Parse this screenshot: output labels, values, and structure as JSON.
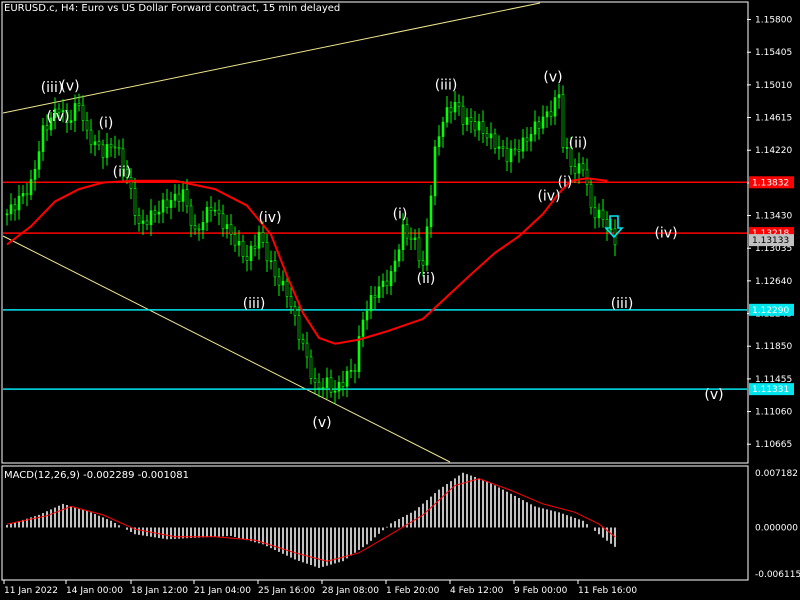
{
  "window": {
    "title": "EURUSD.c, H4:  Euro vs US Dollar Forward contract, 15 min delayed"
  },
  "indicator": {
    "title": "MACD(12,26,9) -0.002289 -0.001081",
    "axis_labels": [
      "0.007182",
      "0.000000",
      "-0.006115"
    ]
  },
  "colors": {
    "background": "#000000",
    "frame": "#ffffff",
    "candles": "#00ff00",
    "moving_average": "#ff0000",
    "support_lines": "#00e5ee",
    "resistance_lines": "#ff0000",
    "trend_lines": "#f0e68c",
    "wave_labels": "#ffffff",
    "histogram": "#c0c0c0",
    "signal_line": "#ff0000",
    "arrow": "#00e5ee"
  },
  "price_axis": {
    "labels": [
      "1.15800",
      "1.15405",
      "1.15010",
      "1.14615",
      "1.14220",
      "1.13825",
      "1.13430",
      "1.13035",
      "1.12640",
      "1.12245",
      "1.11850",
      "1.11455",
      "1.11060",
      "1.10665"
    ],
    "markers": [
      {
        "text": "1.13832",
        "price": 1.13832,
        "color": "#ff0000"
      },
      {
        "text": "1.13218",
        "price": 1.13218,
        "color": "#ff0000"
      },
      {
        "text": "1.13133",
        "price": 1.13133,
        "color": "#c0c0c0"
      },
      {
        "text": "1.12290",
        "price": 1.1229,
        "color": "#00e5ee"
      },
      {
        "text": "1.11331",
        "price": 1.11331,
        "color": "#00e5ee"
      }
    ]
  },
  "time_axis": {
    "labels": [
      "11 Jan 2022",
      "14 Jan 00:00",
      "18 Jan 12:00",
      "21 Jan 04:00",
      "25 Jan 16:00",
      "28 Jan 08:00",
      "1 Feb 20:00",
      "4 Feb 12:00",
      "9 Feb 00:00",
      "11 Feb 16:00"
    ]
  },
  "waves": [
    {
      "text": "(iii)",
      "price": 1.1497
    },
    {
      "text": "(v)",
      "price": 1.1499
    },
    {
      "text": "(iv)",
      "price": 1.1462
    },
    {
      "text": "(i)",
      "price": 1.1454
    },
    {
      "text": "(ii)",
      "price": 1.1395
    },
    {
      "text": "(iv)",
      "price": 1.134
    },
    {
      "text": "(iii)",
      "price": 1.1236
    },
    {
      "text": "(v)",
      "price": 1.1092
    },
    {
      "text": "(i)",
      "price": 1.1344
    },
    {
      "text": "(ii)",
      "price": 1.1266
    },
    {
      "text": "(iii)",
      "price": 1.15
    },
    {
      "text": "(v)",
      "price": 1.151
    },
    {
      "text": "(ii)",
      "price": 1.143
    },
    {
      "text": "(i)",
      "price": 1.1383
    },
    {
      "text": "(iv)",
      "price": 1.1366
    },
    {
      "text": "(iv)",
      "price": 1.1321
    },
    {
      "text": "(iii)",
      "price": 1.1236
    },
    {
      "text": "(v)",
      "price": 1.1126
    }
  ],
  "horizontal_lines": [
    {
      "price": 1.13832,
      "color": "#ff0000"
    },
    {
      "price": 1.13218,
      "color": "#ff0000"
    },
    {
      "price": 1.1229,
      "color": "#00e5ee"
    },
    {
      "price": 1.11331,
      "color": "#00e5ee"
    }
  ],
  "chart_data": {
    "type": "line",
    "symbol": "EURUSD.c",
    "timeframe": "H4",
    "ylim": [
      1.1045,
      1.16
    ],
    "price_path": [
      {
        "bar": 0,
        "price": 1.1345
      },
      {
        "bar": 6,
        "price": 1.138
      },
      {
        "bar": 9,
        "price": 1.1445
      },
      {
        "bar": 13,
        "price": 1.1475
      },
      {
        "bar": 15,
        "price": 1.1455
      },
      {
        "bar": 18,
        "price": 1.148
      },
      {
        "bar": 20,
        "price": 1.144
      },
      {
        "bar": 24,
        "price": 1.142
      },
      {
        "bar": 27,
        "price": 1.143
      },
      {
        "bar": 30,
        "price": 1.139
      },
      {
        "bar": 33,
        "price": 1.133
      },
      {
        "bar": 39,
        "price": 1.1355
      },
      {
        "bar": 44,
        "price": 1.137
      },
      {
        "bar": 47,
        "price": 1.132
      },
      {
        "bar": 51,
        "price": 1.1355
      },
      {
        "bar": 56,
        "price": 1.132
      },
      {
        "bar": 60,
        "price": 1.129
      },
      {
        "bar": 63,
        "price": 1.132
      },
      {
        "bar": 67,
        "price": 1.127
      },
      {
        "bar": 70,
        "price": 1.125
      },
      {
        "bar": 73,
        "price": 1.12
      },
      {
        "bar": 75,
        "price": 1.117
      },
      {
        "bar": 77,
        "price": 1.1135
      },
      {
        "bar": 80,
        "price": 1.114
      },
      {
        "bar": 82,
        "price": 1.113
      },
      {
        "bar": 85,
        "price": 1.115
      },
      {
        "bar": 87,
        "price": 1.116
      },
      {
        "bar": 89,
        "price": 1.122
      },
      {
        "bar": 92,
        "price": 1.125
      },
      {
        "bar": 96,
        "price": 1.127
      },
      {
        "bar": 99,
        "price": 1.1325
      },
      {
        "bar": 102,
        "price": 1.131
      },
      {
        "bar": 104,
        "price": 1.128
      },
      {
        "bar": 107,
        "price": 1.142
      },
      {
        "bar": 109,
        "price": 1.146
      },
      {
        "bar": 112,
        "price": 1.148
      },
      {
        "bar": 114,
        "price": 1.146
      },
      {
        "bar": 118,
        "price": 1.145
      },
      {
        "bar": 122,
        "price": 1.143
      },
      {
        "bar": 125,
        "price": 1.1415
      },
      {
        "bar": 129,
        "price": 1.143
      },
      {
        "bar": 132,
        "price": 1.145
      },
      {
        "bar": 136,
        "price": 1.147
      },
      {
        "bar": 138,
        "price": 1.149
      },
      {
        "bar": 139,
        "price": 1.143
      },
      {
        "bar": 142,
        "price": 1.1395
      },
      {
        "bar": 144,
        "price": 1.1405
      },
      {
        "bar": 146,
        "price": 1.135
      },
      {
        "bar": 149,
        "price": 1.134
      },
      {
        "bar": 151,
        "price": 1.132
      },
      {
        "bar": 152,
        "price": 1.1313
      }
    ],
    "moving_average": [
      {
        "bar": 0,
        "price": 1.1308
      },
      {
        "bar": 6,
        "price": 1.133
      },
      {
        "bar": 12,
        "price": 1.136
      },
      {
        "bar": 18,
        "price": 1.1375
      },
      {
        "bar": 24,
        "price": 1.1383
      },
      {
        "bar": 32,
        "price": 1.1385
      },
      {
        "bar": 42,
        "price": 1.1385
      },
      {
        "bar": 52,
        "price": 1.1375
      },
      {
        "bar": 60,
        "price": 1.1355
      },
      {
        "bar": 66,
        "price": 1.132
      },
      {
        "bar": 70,
        "price": 1.127
      },
      {
        "bar": 74,
        "price": 1.1225
      },
      {
        "bar": 78,
        "price": 1.1195
      },
      {
        "bar": 82,
        "price": 1.1188
      },
      {
        "bar": 88,
        "price": 1.1193
      },
      {
        "bar": 95,
        "price": 1.1203
      },
      {
        "bar": 104,
        "price": 1.1218
      },
      {
        "bar": 110,
        "price": 1.1245
      },
      {
        "bar": 116,
        "price": 1.1272
      },
      {
        "bar": 122,
        "price": 1.1298
      },
      {
        "bar": 128,
        "price": 1.1318
      },
      {
        "bar": 134,
        "price": 1.1345
      },
      {
        "bar": 138,
        "price": 1.137
      },
      {
        "bar": 141,
        "price": 1.1385
      },
      {
        "bar": 145,
        "price": 1.1388
      },
      {
        "bar": 150,
        "price": 1.1385
      }
    ],
    "macd": {
      "ylim": [
        -0.006115,
        0.007182
      ],
      "histogram": [
        {
          "bar": 0,
          "value": 0.0003
        },
        {
          "bar": 8,
          "value": 0.0015
        },
        {
          "bar": 14,
          "value": 0.0028
        },
        {
          "bar": 20,
          "value": 0.002
        },
        {
          "bar": 26,
          "value": 0.0008
        },
        {
          "bar": 32,
          "value": -0.0008
        },
        {
          "bar": 40,
          "value": -0.0014
        },
        {
          "bar": 48,
          "value": -0.0012
        },
        {
          "bar": 56,
          "value": -0.001
        },
        {
          "bar": 64,
          "value": -0.002
        },
        {
          "bar": 72,
          "value": -0.0038
        },
        {
          "bar": 78,
          "value": -0.0048
        },
        {
          "bar": 84,
          "value": -0.004
        },
        {
          "bar": 90,
          "value": -0.002
        },
        {
          "bar": 96,
          "value": 0.0005
        },
        {
          "bar": 102,
          "value": 0.002
        },
        {
          "bar": 108,
          "value": 0.0045
        },
        {
          "bar": 114,
          "value": 0.0065
        },
        {
          "bar": 120,
          "value": 0.0055
        },
        {
          "bar": 126,
          "value": 0.004
        },
        {
          "bar": 132,
          "value": 0.0025
        },
        {
          "bar": 138,
          "value": 0.0018
        },
        {
          "bar": 144,
          "value": 0.0008
        },
        {
          "bar": 149,
          "value": -0.0012
        },
        {
          "bar": 152,
          "value": -0.0023
        }
      ],
      "signal": [
        {
          "bar": 0,
          "value": 0.0004
        },
        {
          "bar": 10,
          "value": 0.0014
        },
        {
          "bar": 16,
          "value": 0.0025
        },
        {
          "bar": 24,
          "value": 0.0015
        },
        {
          "bar": 32,
          "value": -0.0002
        },
        {
          "bar": 42,
          "value": -0.0011
        },
        {
          "bar": 52,
          "value": -0.0011
        },
        {
          "bar": 62,
          "value": -0.0015
        },
        {
          "bar": 72,
          "value": -0.003
        },
        {
          "bar": 80,
          "value": -0.004
        },
        {
          "bar": 88,
          "value": -0.003
        },
        {
          "bar": 96,
          "value": -0.0008
        },
        {
          "bar": 104,
          "value": 0.0015
        },
        {
          "bar": 112,
          "value": 0.005
        },
        {
          "bar": 118,
          "value": 0.0058
        },
        {
          "bar": 126,
          "value": 0.0044
        },
        {
          "bar": 134,
          "value": 0.0028
        },
        {
          "bar": 142,
          "value": 0.0018
        },
        {
          "bar": 148,
          "value": 0.0004
        },
        {
          "bar": 152,
          "value": -0.0011
        }
      ]
    }
  }
}
